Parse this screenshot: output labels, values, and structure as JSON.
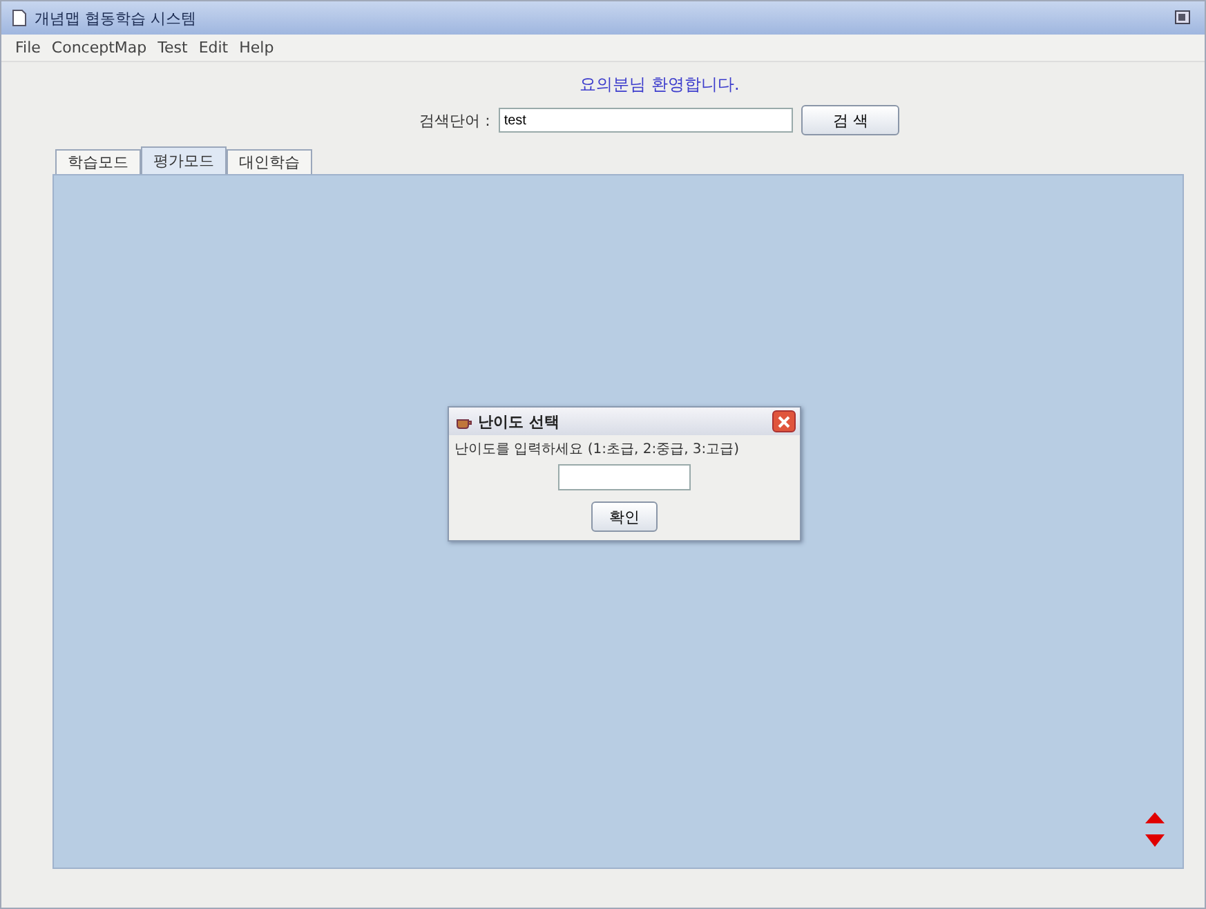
{
  "window": {
    "title": "개념맵 협동학습 시스템"
  },
  "menu": [
    "File",
    "ConceptMap",
    "Test",
    "Edit",
    "Help"
  ],
  "welcome": "요의분님 환영합니다.",
  "search": {
    "label": "검색단어 :",
    "value": "test",
    "button": "검 색"
  },
  "tabs": [
    {
      "label": "학습모드",
      "selected": false
    },
    {
      "label": "평가모드",
      "selected": true
    },
    {
      "label": "대인학습",
      "selected": false
    }
  ],
  "dialog": {
    "title": "난이도 선택",
    "message": "난이도를 입력하세요 (1:초급, 2:중급, 3:고급)",
    "button": "확인"
  }
}
